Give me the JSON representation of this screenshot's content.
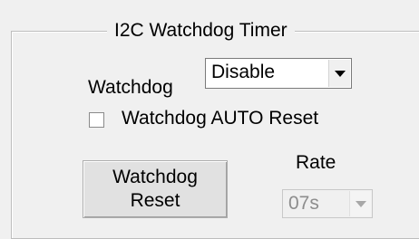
{
  "group": {
    "title": "I2C Watchdog Timer"
  },
  "watchdog": {
    "label": "Watchdog",
    "selected": "Disable"
  },
  "auto_reset": {
    "label": "Watchdog AUTO Reset",
    "checked": false
  },
  "reset_button": {
    "line1": "Watchdog",
    "line2": "Reset"
  },
  "rate": {
    "label": "Rate",
    "selected": "07s",
    "disabled": true
  }
}
